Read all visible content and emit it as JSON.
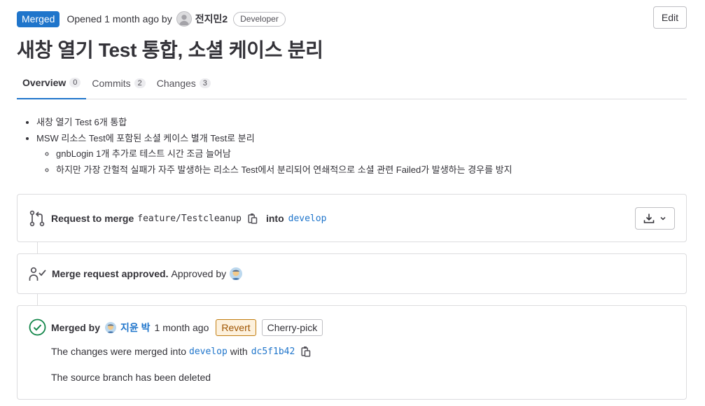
{
  "header": {
    "status_badge": "Merged",
    "opened_text": "Opened 1 month ago by",
    "author": "전지민2",
    "role": "Developer",
    "edit_label": "Edit"
  },
  "title": "새창 열기 Test 통합, 소셜 케이스 분리",
  "tabs": [
    {
      "label": "Overview",
      "count": "0"
    },
    {
      "label": "Commits",
      "count": "2"
    },
    {
      "label": "Changes",
      "count": "3"
    }
  ],
  "description": {
    "items": [
      "새창 열기 Test 6개 통합",
      "MSW 리소스 Test에 포함된 소셜 케이스 별개 Test로 분리"
    ],
    "sub_items": [
      "gnbLogin 1개 추가로 테스트 시간 조금 늘어남",
      "하지만 가장 간헐적 실패가 자주 발생하는 리소스 Test에서 분리되어 연쇄적으로 소셜 관련 Failed가 발생하는 경우를 방지"
    ]
  },
  "merge_request": {
    "label": "Request to merge",
    "source_branch": "feature/Testcleanup",
    "into": "into",
    "target_branch": "develop"
  },
  "approval": {
    "label": "Merge request approved.",
    "approved_by": "Approved by"
  },
  "merged": {
    "label": "Merged by",
    "user": "지윤 박",
    "time": "1 month ago",
    "revert_label": "Revert",
    "cherry_pick_label": "Cherry-pick",
    "changes_prefix": "The changes were merged into",
    "target_branch": "develop",
    "with": "with",
    "commit_sha": "dc5f1b42",
    "branch_deleted": "The source branch has been deleted"
  },
  "colors": {
    "accent": "#1f75cb",
    "success": "#108548",
    "revert": "#9e5400"
  }
}
